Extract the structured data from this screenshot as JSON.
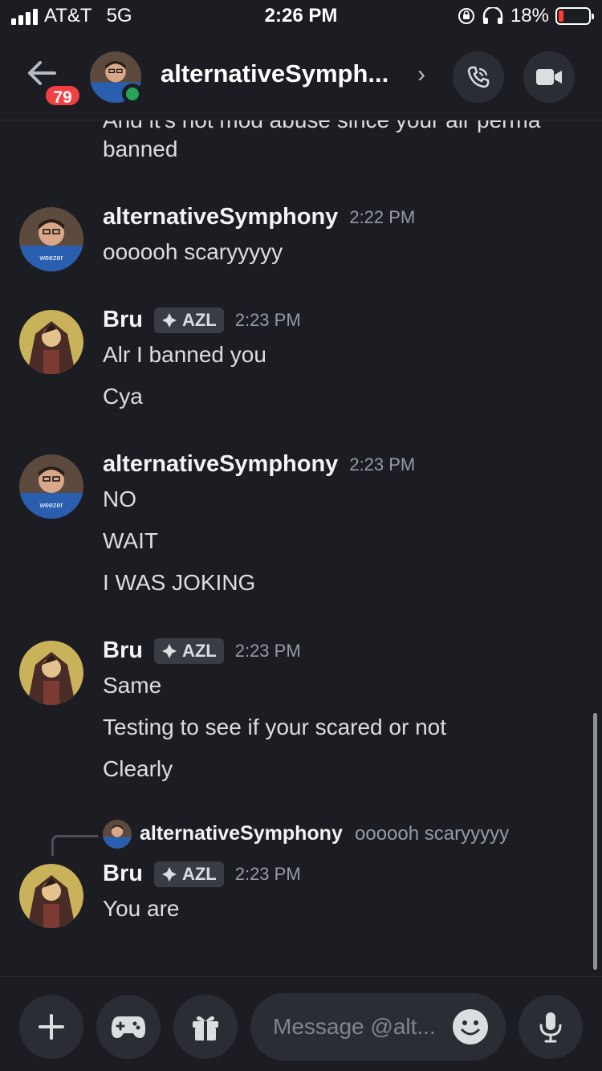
{
  "status_bar": {
    "carrier": "AT&T",
    "network": "5G",
    "time": "2:26 PM",
    "battery": "18%",
    "battery_level": 0.18
  },
  "header": {
    "title": "alternativeSymph...",
    "unread_badge": "79"
  },
  "previous_message": {
    "line1": "And it's not mod abuse since your alr perma",
    "line2": "banned"
  },
  "messages": [
    {
      "author": "alternativeSymphony",
      "time": "2:22 PM",
      "lines": [
        "oooooh scaryyyyy"
      ]
    },
    {
      "author": "Bru",
      "tag": "AZL",
      "time": "2:23 PM",
      "lines": [
        "Alr I banned you",
        "Cya"
      ]
    },
    {
      "author": "alternativeSymphony",
      "time": "2:23 PM",
      "lines": [
        "NO",
        "WAIT",
        "I WAS JOKING"
      ]
    },
    {
      "author": "Bru",
      "tag": "AZL",
      "time": "2:23 PM",
      "lines": [
        "Same",
        "Testing to see if your scared or not",
        "Clearly"
      ]
    },
    {
      "author": "Bru",
      "tag": "AZL",
      "time": "2:23 PM",
      "lines": [
        "You are"
      ],
      "reply_to": {
        "author": "alternativeSymphony",
        "text": "oooooh scaryyyyy"
      }
    }
  ],
  "composer": {
    "placeholder": "Message @alt..."
  },
  "icons": {
    "back": "arrow-left-icon",
    "call": "phone-call-icon",
    "video": "video-camera-icon",
    "plus": "plus-icon",
    "games": "gamepad-icon",
    "gift": "gift-icon",
    "emoji": "emoji-icon",
    "mic": "microphone-icon",
    "tag": "diamond-tag-icon"
  },
  "colors": {
    "background": "#1c1d23",
    "badge": "#f23f43",
    "online": "#23a55a",
    "timestamp": "#949ba4",
    "battery_low": "#ff3b30"
  }
}
